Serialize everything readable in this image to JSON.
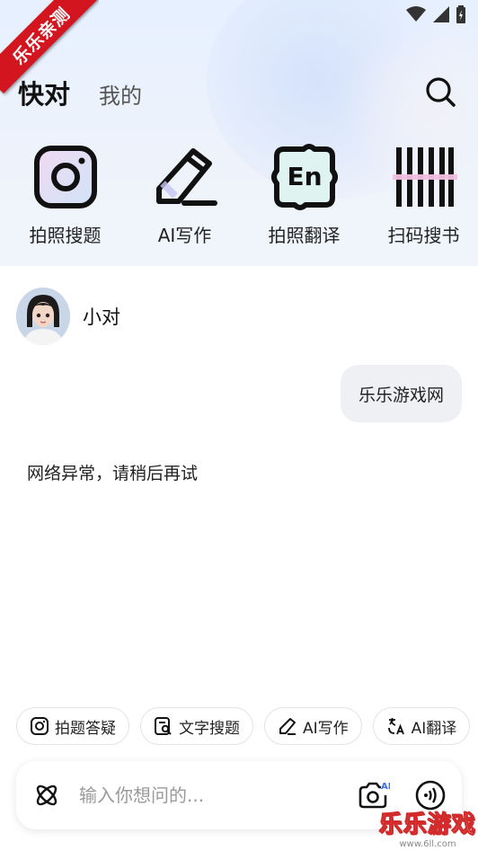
{
  "watermark_ribbon": "乐乐亲测",
  "header": {
    "tabs": [
      {
        "label": "快对",
        "active": true
      },
      {
        "label": "我的",
        "active": false
      }
    ],
    "search_icon": "search-icon"
  },
  "tools": [
    {
      "label": "拍照搜题",
      "icon": "camera-icon"
    },
    {
      "label": "AI写作",
      "icon": "pencil-icon"
    },
    {
      "label": "拍照翻译",
      "icon": "translate-en-icon"
    },
    {
      "label": "扫码搜书",
      "icon": "barcode-icon"
    }
  ],
  "chat": {
    "bot_name": "小对",
    "user_message": "乐乐游戏网",
    "bot_reply": "网络异常，请稍后再试"
  },
  "quick_chips": [
    {
      "label": "拍题答疑",
      "icon": "camera-icon"
    },
    {
      "label": "文字搜题",
      "icon": "text-search-icon"
    },
    {
      "label": "AI写作",
      "icon": "pencil-icon"
    },
    {
      "label": "AI翻译",
      "icon": "translate-icon"
    }
  ],
  "input": {
    "placeholder": "输入你想问的...",
    "value": ""
  },
  "watermark": {
    "title": "乐乐游戏",
    "url": "www.6ll.com"
  },
  "colors": {
    "accent_red": "#d2151f",
    "header_bg": "#e6f0ff"
  }
}
